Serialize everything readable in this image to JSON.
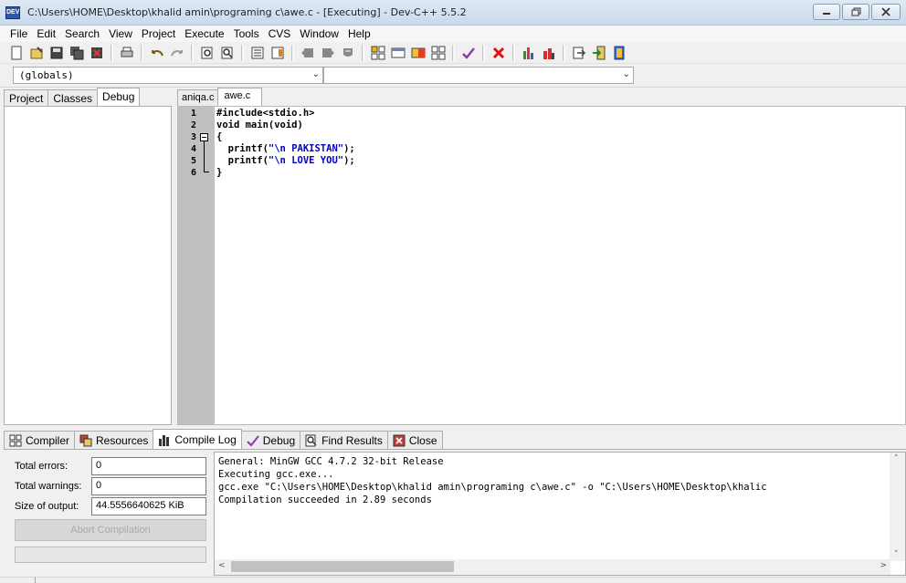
{
  "window": {
    "title": "C:\\Users\\HOME\\Desktop\\khalid amin\\programing c\\awe.c - [Executing] - Dev-C++ 5.5.2",
    "icon_name": "dev-cpp-icon",
    "icon_text": "DEV"
  },
  "menu": [
    "File",
    "Edit",
    "Search",
    "View",
    "Project",
    "Execute",
    "Tools",
    "CVS",
    "Window",
    "Help"
  ],
  "toolbar": {
    "icons": [
      "new-file-icon",
      "open-icon",
      "save-icon",
      "save-all-icon",
      "close-icon",
      "print-icon",
      "undo-icon",
      "redo-icon",
      "find-icon",
      "replace-icon",
      "compile-icon",
      "run-icon",
      "indent-icon",
      "unindent-icon",
      "toggle-comment-icon",
      "new-project-icon",
      "add-to-project-icon",
      "remove-from-project-icon",
      "project-options-icon",
      "check-syntax-icon",
      "stop-icon",
      "profile-icon",
      "debug-icon",
      "goto-icon",
      "exit-icon",
      "about-icon"
    ]
  },
  "scope_combo": {
    "value": "(globals)"
  },
  "member_combo": {
    "value": ""
  },
  "left_tabs": [
    "Project",
    "Classes",
    "Debug"
  ],
  "left_active_tab": "Debug",
  "editor_tabs": [
    "aniqa.c",
    "awe.c"
  ],
  "editor_active_tab": "awe.c",
  "code": {
    "line_numbers": [
      "1",
      "2",
      "3",
      "4",
      "5",
      "6"
    ],
    "lines": [
      {
        "text": "#include<stdio.h>",
        "string": ""
      },
      {
        "text": "void main(void)",
        "string": ""
      },
      {
        "text": "{",
        "string": ""
      },
      {
        "text": "  printf(",
        "string": "\"\\n PAKISTAN\"",
        "tail": ");"
      },
      {
        "text": "  printf(",
        "string": "\"\\n LOVE YOU\"",
        "tail": ");"
      },
      {
        "text": "}",
        "string": ""
      }
    ]
  },
  "bottom_tabs": [
    {
      "label": "Compiler",
      "icon": "compiler-grid-icon"
    },
    {
      "label": "Resources",
      "icon": "resources-icon"
    },
    {
      "label": "Compile Log",
      "icon": "compile-log-chart-icon"
    },
    {
      "label": "Debug",
      "icon": "debug-check-icon"
    },
    {
      "label": "Find Results",
      "icon": "find-results-icon"
    },
    {
      "label": "Close",
      "icon": "close-panel-icon"
    }
  ],
  "bottom_active_tab": "Compile Log",
  "stats": {
    "errors_label": "Total errors:",
    "errors_value": "0",
    "warnings_label": "Total warnings:",
    "warnings_value": "0",
    "size_label": "Size of output:",
    "size_value": "44.5556640625 KiB"
  },
  "abort_button": "Abort Compilation",
  "log_lines": [
    "General: MinGW GCC 4.7.2 32-bit Release",
    "Executing gcc.exe...",
    "gcc.exe \"C:\\Users\\HOME\\Desktop\\khalid amin\\programing c\\awe.c\" -o \"C:\\Users\\HOME\\Desktop\\khalic",
    "Compilation succeeded in 2.89 seconds"
  ],
  "colors": {
    "code_string": "#0000c8",
    "gutter": "#c0c0c0",
    "titlebar": "#c9d9ec"
  }
}
